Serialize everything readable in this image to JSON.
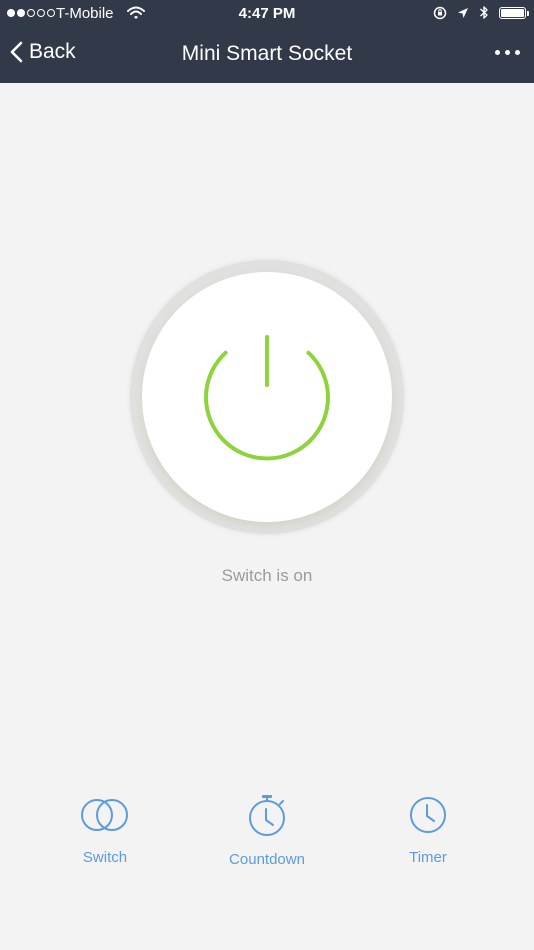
{
  "status_bar": {
    "carrier": "T-Mobile",
    "time": "4:47 PM",
    "signal_bars_filled": 2,
    "signal_bars_total": 5,
    "icons": [
      "wifi-icon",
      "orientation-lock-icon",
      "location-arrow-icon",
      "bluetooth-icon",
      "battery-icon"
    ]
  },
  "nav": {
    "back_label": "Back",
    "title": "Mini Smart Socket",
    "back_icon": "chevron-left-icon",
    "more_icon": "more-dots-icon"
  },
  "power": {
    "state": "on",
    "status_text": "Switch is on",
    "icon": "power-icon"
  },
  "tabs": [
    {
      "label": "Switch",
      "icon": "switch-icon"
    },
    {
      "label": "Countdown",
      "icon": "stopwatch-icon"
    },
    {
      "label": "Timer",
      "icon": "clock-icon"
    }
  ],
  "colors": {
    "header_bg": "#323a4a",
    "page_bg": "#f3f3f3",
    "power_on": "#8fd33c",
    "tab_blue": "#5d9be0",
    "status_text": "#9b9b9b"
  }
}
